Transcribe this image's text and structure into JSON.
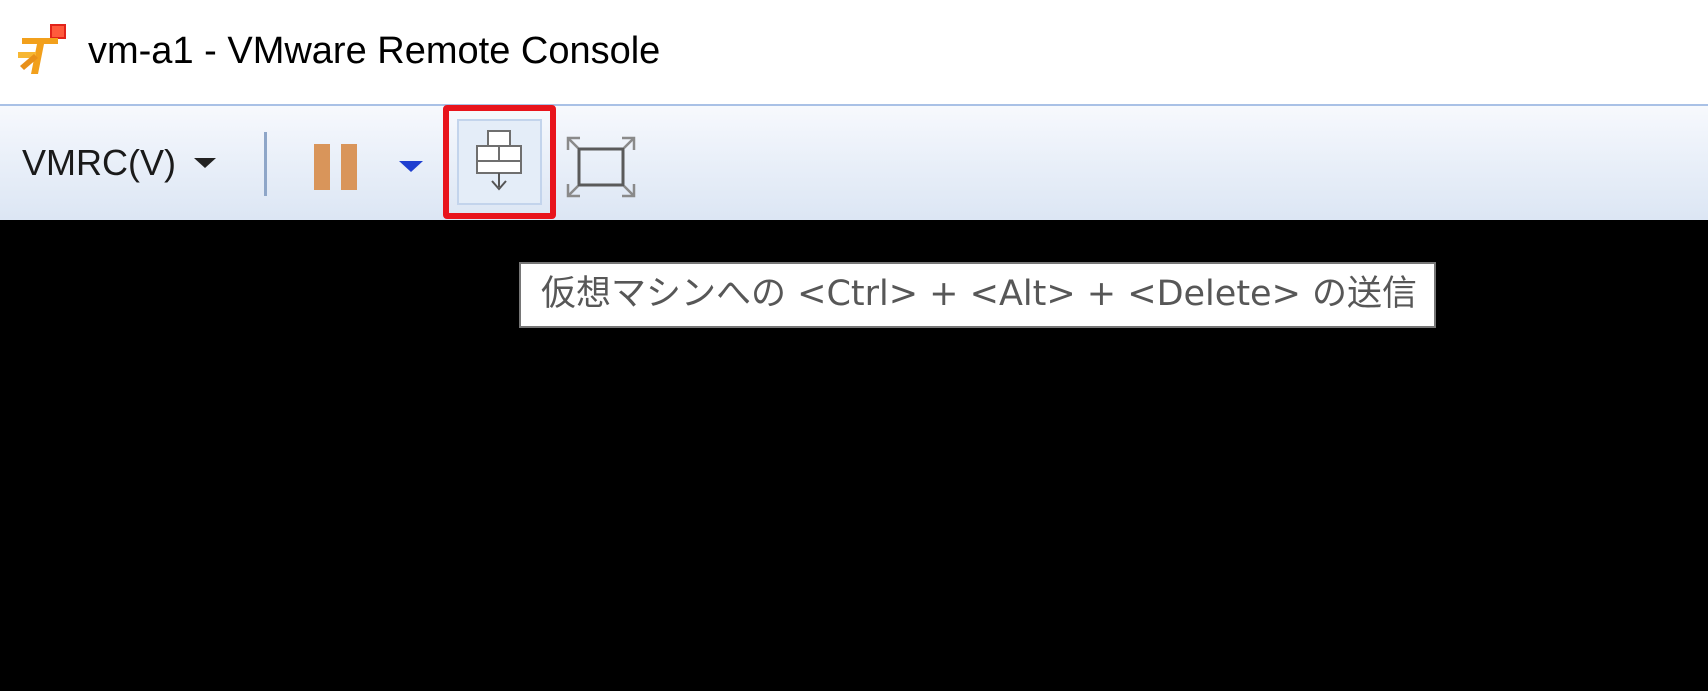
{
  "window": {
    "title": "vm-a1 - VMware Remote Console",
    "app_icon": "vmware-pin-icon"
  },
  "toolbar": {
    "vmrc_menu_label": "VMRC(V)",
    "vmrc_menu_icon": "chevron-down-icon",
    "pause_icon": "pause-icon",
    "power_dropdown_icon": "chevron-down-icon",
    "send_cad_icon": "keyboard-send-icon",
    "fullscreen_icon": "fullscreen-icon",
    "send_cad_highlighted": true
  },
  "tooltip": {
    "text": "仮想マシンへの <Ctrl> + <Alt> + <Delete> の送信"
  },
  "colors": {
    "highlight": "#e8141c",
    "pause": "#d9955a",
    "dropdown_arrow": "#1f3fd0",
    "console_background": "#000000"
  }
}
